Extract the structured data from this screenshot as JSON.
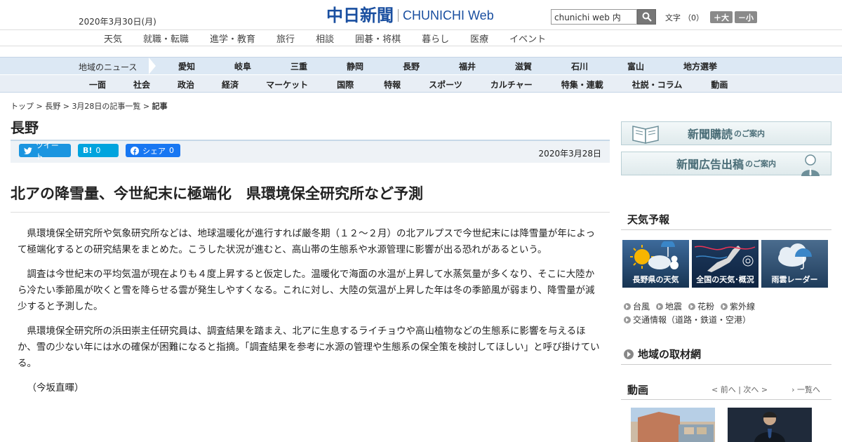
{
  "header": {
    "date": "2020年3月30日(月)",
    "logo_jp": "中日新聞",
    "logo_en_main": "CHUNICHI",
    "logo_en_web": "Web",
    "search_value": "chunichi web 内",
    "font_label": "文字",
    "font_count": "（0）",
    "font_larger": "＋大",
    "font_smaller": "－小"
  },
  "category_nav": [
    "天気",
    "就職・転職",
    "進学・教育",
    "旅行",
    "相談",
    "囲碁・将棋",
    "暮らし",
    "医療",
    "イベント"
  ],
  "region_nav": {
    "title": "地域のニュース",
    "items": [
      "愛知",
      "岐阜",
      "三重",
      "静岡",
      "長野",
      "福井",
      "滋賀",
      "石川",
      "富山",
      "地方選挙"
    ]
  },
  "section_nav": [
    "一面",
    "社会",
    "政治",
    "経済",
    "マーケット",
    "国際",
    "特報",
    "スポーツ",
    "カルチャー",
    "特集・連載",
    "社説・コラム",
    "動画"
  ],
  "breadcrumb": {
    "top": "トップ",
    "region": "長野",
    "list": "3月28日の記事一覧",
    "current": "記事",
    "sep": " > "
  },
  "page_title": "長野",
  "social": {
    "tweet": "ツイート",
    "hatena": "B!",
    "hatena_count": "0",
    "share": "シェア",
    "share_count": "0",
    "date": "2020年3月28日"
  },
  "article": {
    "headline": "北アの降雪量、今世紀末に極端化　県環境保全研究所など予測",
    "paragraphs": [
      "県環境保全研究所や気象研究所などは、地球温暖化が進行すれば厳冬期（１２～２月）の北アルプスで今世紀末には降雪量が年によって極端化するとの研究結果をまとめた。こうした状況が進むと、高山帯の生態系や水源管理に影響が出る恐れがあるという。",
      "調査は今世紀末の平均気温が現在よりも４度上昇すると仮定した。温暖化で海面の水温が上昇して水蒸気量が多くなり、そこに大陸から冷たい季節風が吹くと雪を降らせる雲が発生しやすくなる。これに対し、大陸の気温が上昇した年は冬の季節風が弱まり、降雪量が減少すると予測した。",
      "県環境保全研究所の浜田崇主任研究員は、調査結果を踏まえ、北アに生息するライチョウや高山植物などの生態系に影響を与えるほか、雪の少ない年には水の確保が困難になると指摘。「調査結果を参考に水源の管理や生態系の保全策を検討してほしい」と呼び掛けている。",
      "（今坂直暉）"
    ]
  },
  "sidebar": {
    "promo_subscribe": "新聞購読",
    "promo_subscribe_suffix": "のご案内",
    "promo_ads": "新聞広告出稿",
    "promo_ads_suffix": "のご案内",
    "weather_title": "天気予報",
    "weather_tiles": [
      "長野県の天気",
      "全国の天気･概況",
      "雨雲レーダー"
    ],
    "weather_links": [
      "台風",
      "地震",
      "花粉",
      "紫外線",
      "交通情報（道路・鉄道・空港）"
    ],
    "region_network": "地域の取材網",
    "video_title": "動画",
    "video_prev": "< 前へ",
    "video_next": "次へ >",
    "video_sep": " | ",
    "video_all": "一覧へ"
  },
  "colors": {
    "brand": "#1a4fa0",
    "nav_bg": "#dce8f4",
    "twitter": "#1b95e0",
    "hatena": "#00a4de",
    "facebook": "#1877f2"
  }
}
